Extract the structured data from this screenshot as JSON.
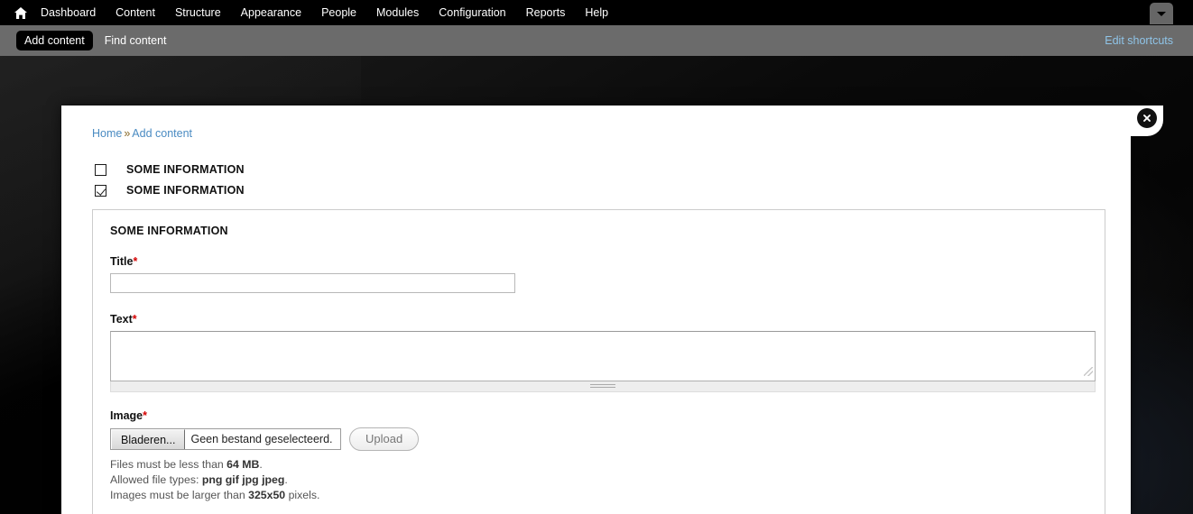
{
  "toolbar": {
    "home_icon": "home-icon",
    "items": [
      {
        "label": "Dashboard"
      },
      {
        "label": "Content"
      },
      {
        "label": "Structure"
      },
      {
        "label": "Appearance"
      },
      {
        "label": "People"
      },
      {
        "label": "Modules"
      },
      {
        "label": "Configuration"
      },
      {
        "label": "Reports"
      },
      {
        "label": "Help"
      }
    ],
    "toggle_icon": "chevron-down-icon"
  },
  "shortcut_bar": {
    "links": [
      {
        "label": "Add content",
        "active": true
      },
      {
        "label": "Find content",
        "active": false
      }
    ],
    "edit_shortcuts_label": "Edit shortcuts",
    "edit_shortcuts_color": "#8fc4e8"
  },
  "modal": {
    "close_icon": "close-icon",
    "breadcrumb": {
      "home_label": "Home",
      "separator": "»",
      "current_label": "Add content"
    },
    "checkboxes": [
      {
        "label": "SOME INFORMATION",
        "checked": false
      },
      {
        "label": "SOME INFORMATION",
        "checked": true
      }
    ],
    "fieldset": {
      "legend": "SOME INFORMATION",
      "title_field": {
        "label": "Title",
        "required_marker": "*",
        "value": "",
        "placeholder": ""
      },
      "text_field": {
        "label": "Text",
        "required_marker": "*",
        "value": "",
        "placeholder": ""
      },
      "image_field": {
        "label": "Image",
        "required_marker": "*",
        "browse_label": "Bladeren...",
        "file_status": "Geen bestand geselecteerd.",
        "upload_label": "Upload",
        "help": [
          {
            "prefix": "Files must be less than ",
            "strong": "64 MB",
            "suffix": "."
          },
          {
            "prefix": "Allowed file types: ",
            "strong": "png gif jpg jpeg",
            "suffix": "."
          },
          {
            "prefix": "Images must be larger than ",
            "strong": "325x50",
            "suffix": " pixels."
          }
        ]
      }
    }
  },
  "colors": {
    "toolbar_bg": "#000000",
    "shortcut_bg": "#6b6b6b",
    "link_blue": "#4a8bc2",
    "required_red": "#d40000"
  }
}
